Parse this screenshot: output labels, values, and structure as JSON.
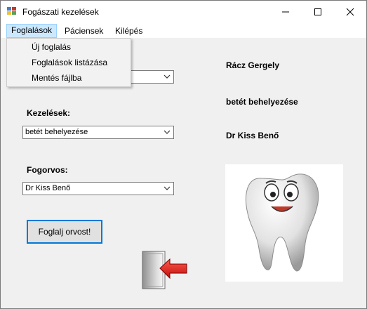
{
  "window": {
    "title": "Fogászati kezelések"
  },
  "menu": {
    "items": [
      {
        "label": "Foglalások"
      },
      {
        "label": "Páciensek"
      },
      {
        "label": "Kilépés"
      }
    ],
    "dropdown": [
      {
        "label": "Új foglalás"
      },
      {
        "label": "Foglalások listázása"
      },
      {
        "label": "Mentés fájlba"
      }
    ]
  },
  "form": {
    "patient_combo_value": "",
    "treatment_label": "Kezelések:",
    "treatment_value": "betét behelyezése",
    "dentist_label": "Fogorvos:",
    "dentist_value": "Dr Kiss Benő",
    "book_button": "Foglalj orvost!"
  },
  "summary": {
    "patient": "Rácz Gergely",
    "treatment": "betét behelyezése",
    "dentist": "Dr Kiss Benő"
  },
  "icons": [
    "app-icon",
    "minimize-icon",
    "maximize-icon",
    "close-icon",
    "dropdown-arrow-icon",
    "tooth-icon",
    "exit-door-icon"
  ],
  "colors": {
    "accent": "#0078d7",
    "menu_highlight": "#cce8ff",
    "exit_arrow": "#e0201b"
  }
}
